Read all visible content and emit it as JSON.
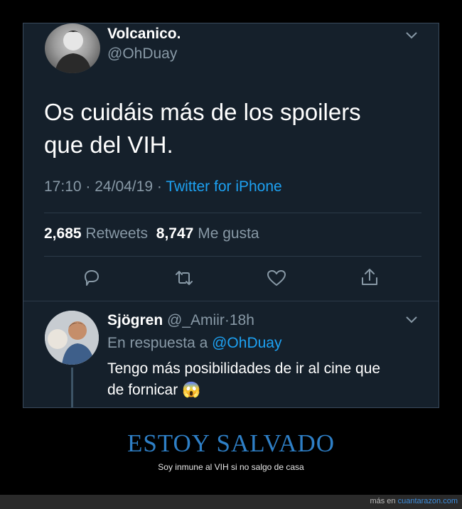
{
  "tweet": {
    "display_name": "Volcanico.",
    "handle": "@OhDuay",
    "text_line1": "Os cuidáis más de los spoilers",
    "text_line2": "que del VIH.",
    "time": "17:10",
    "sep1": "·",
    "date": "24/04/19",
    "sep2": "·",
    "source": "Twitter for iPhone",
    "retweets_count": "2,685",
    "retweets_label": "Retweets",
    "likes_count": "8,747",
    "likes_label": "Me gusta"
  },
  "reply": {
    "display_name": "Sjögren",
    "handle": "@_Amiir",
    "sep": "·",
    "age": "18h",
    "in_reply_prefix": "En respuesta a",
    "in_reply_handle": "@OhDuay",
    "text_line1": "Tengo más posibilidades de ir al cine que",
    "text_line2": "de fornicar",
    "emoji": "😱"
  },
  "caption": {
    "title": "ESTOY SALVADO",
    "subtitle": "Soy inmune al VIH si no salgo de casa"
  },
  "footer": {
    "prefix": "más en",
    "site": "cuantarazon.com"
  },
  "colors": {
    "background": "#15202b",
    "accent": "#1da1f2",
    "muted": "#8899a6",
    "caption": "#2e7fc6"
  }
}
